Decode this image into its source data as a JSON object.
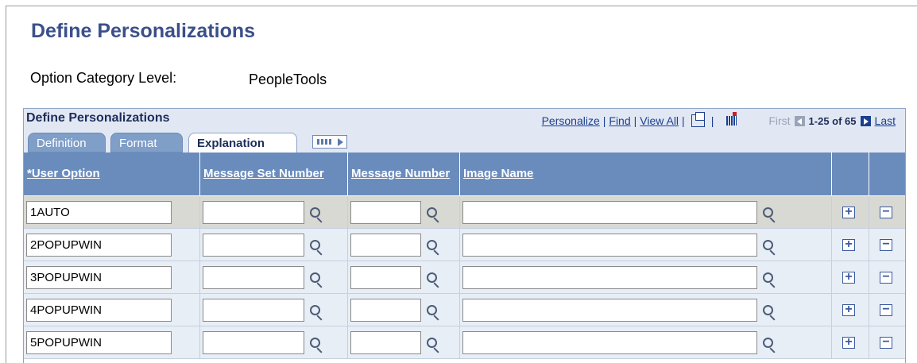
{
  "page": {
    "title": "Define Personalizations",
    "option_category_label": "Option Category Level:",
    "option_category_value": "PeopleTools"
  },
  "grid": {
    "title": "Define Personalizations",
    "nav": {
      "personalize": "Personalize",
      "find": "Find",
      "view_all": "View All",
      "first": "First",
      "range": "1-25 of 65",
      "last": "Last"
    },
    "tabs": [
      {
        "label": "Definition",
        "active": false
      },
      {
        "label": "Format",
        "active": false
      },
      {
        "label": "Explanation",
        "active": true
      }
    ],
    "columns": {
      "user_option_required": "*",
      "user_option": "User Option",
      "message_set_number": "Message Set Number",
      "message_number": "Message Number",
      "image_name": "Image Name"
    },
    "rows": [
      {
        "user_option": "1AUTO",
        "message_set_number": "",
        "message_number": "",
        "image_name": ""
      },
      {
        "user_option": "2POPUPWIN",
        "message_set_number": "",
        "message_number": "",
        "image_name": ""
      },
      {
        "user_option": "3POPUPWIN",
        "message_set_number": "",
        "message_number": "",
        "image_name": ""
      },
      {
        "user_option": "4POPUPWIN",
        "message_set_number": "",
        "message_number": "",
        "image_name": ""
      },
      {
        "user_option": "5POPUPWIN",
        "message_set_number": "",
        "message_number": "",
        "image_name": ""
      }
    ],
    "add_row_symbol": "+",
    "delete_row_symbol": "−"
  },
  "colors": {
    "title": "#3b4f8a",
    "header_bg": "#6a8cbd",
    "link": "#1b3f8f"
  }
}
